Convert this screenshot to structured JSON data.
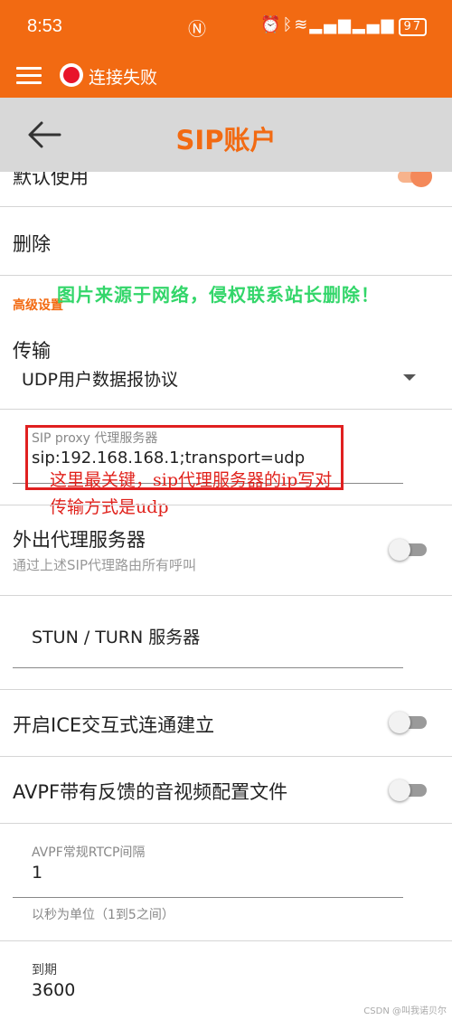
{
  "status_bar": {
    "time": "8:53",
    "battery": "97",
    "icons": [
      "nfc-icon",
      "alarm-icon",
      "bluetooth-icon",
      "vibrate-icon",
      "wifi-icon",
      "signal-icon",
      "signal-icon",
      "battery-icon"
    ]
  },
  "app_bar": {
    "connection_status": "连接失败",
    "status_color": "#e8142a"
  },
  "title_bar": {
    "title": "SIP账户"
  },
  "settings": {
    "default_use": "默认使用",
    "delete": "删除",
    "advanced_header": "高级设置",
    "transport": {
      "label": "传输",
      "value": "UDP用户数据报协议"
    },
    "proxy": {
      "label": "SIP proxy 代理服务器",
      "value": "sip:192.168.168.1;transport=udp"
    },
    "outbound_proxy": {
      "label": "外出代理服务器",
      "sub": "通过上述SIP代理路由所有呼叫"
    },
    "stun": {
      "placeholder": "STUN / TURN 服务器"
    },
    "ice": {
      "label": "开启ICE交互式连通建立"
    },
    "avpf": {
      "label": "AVPF带有反馈的音视频配置文件"
    },
    "rtcp": {
      "label": "AVPF常规RTCP间隔",
      "value": "1",
      "hint": "以秒为单位（1到5之间）"
    },
    "expire": {
      "label": "到期",
      "value": "3600"
    }
  },
  "annotations": {
    "line1": "这里最关键，sip代理服务器的ip写对",
    "line2": "传输方式是udp",
    "watermark": "图片来源于网络，侵权联系站长删除！",
    "credit": "CSDN @叫我诺贝尔"
  },
  "colors": {
    "accent": "#f26a12",
    "annotation": "#e0201a",
    "watermark": "#33d66a"
  }
}
